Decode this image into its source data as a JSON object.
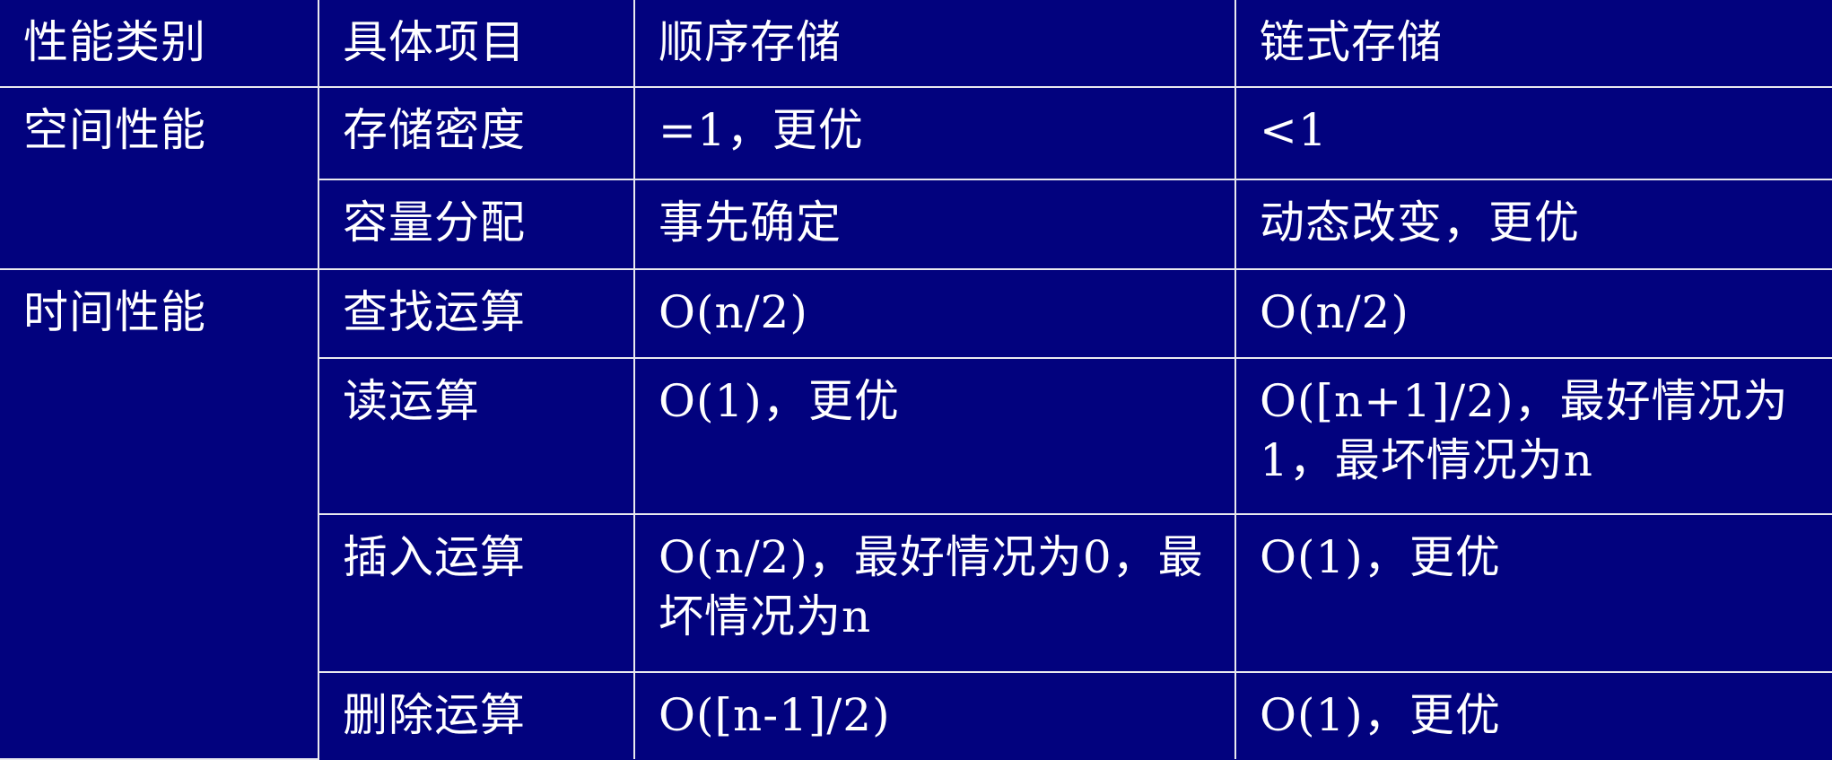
{
  "table": {
    "headers": [
      "性能类别",
      "具体项目",
      "顺序存储",
      "链式存储"
    ],
    "groups": [
      {
        "category": "空间性能",
        "rows": [
          {
            "item": "存储密度",
            "sequential": "=1，更优",
            "linked": "<1"
          },
          {
            "item": "容量分配",
            "sequential": "事先确定",
            "linked": "动态改变，更优"
          }
        ]
      },
      {
        "category": "时间性能",
        "rows": [
          {
            "item": "查找运算",
            "sequential": "O(n/2)",
            "linked": "O(n/2)"
          },
          {
            "item": "读运算",
            "sequential": "O(1)，更优",
            "linked": "O([n+1]/2)，最好情况为1，最坏情况为n"
          },
          {
            "item": "插入运算",
            "sequential": "O(n/2)，最好情况为0，最坏情况为n",
            "linked": "O(1)，更优"
          },
          {
            "item": "删除运算",
            "sequential": "O([n-1]/2)",
            "linked": "O(1)，更优"
          }
        ]
      }
    ]
  },
  "colors": {
    "background": "#02027e",
    "grid": "#e9e9ef",
    "text": "#ffffff"
  }
}
